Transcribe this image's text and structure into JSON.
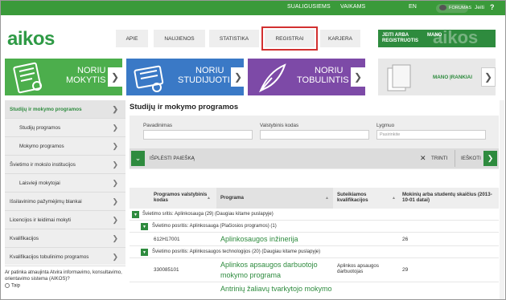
{
  "topbar": {
    "links": [
      "SUALIGUSIEMS",
      "VAIKAMS",
      "EN"
    ],
    "forum_label": "FORUMAS",
    "login_label": "Jeiti",
    "help_label": "?"
  },
  "header": {
    "logo": "aikos",
    "nav": [
      "APIE",
      "NAUJIENOS",
      "STATISTIKA",
      "REGISTRAI",
      "KARJERA"
    ],
    "register_line1": "JEITI ARBA",
    "register_line2": "REGISTRUOTIS",
    "mano_line1": "MANO",
    "mano_watermark": "aikos"
  },
  "tiles": [
    {
      "label1": "NORIU",
      "label2": "MOKYTIS",
      "icon": "certificate-icon",
      "color": "#4cae4c"
    },
    {
      "label1": "NORIU",
      "label2": "STUDIJUOTI",
      "icon": "diploma-icon",
      "color": "#3a79c6"
    },
    {
      "label1": "NORIU",
      "label2": "TOBULINTIS",
      "icon": "quill-icon",
      "color": "#7d4aa7"
    },
    {
      "label1": "MANO ĮRANKIAI",
      "icon": "documents-icon",
      "color": "#e8e8e8"
    }
  ],
  "sidebar": {
    "items": [
      {
        "label": "Studijų ir mokymo programos"
      },
      {
        "label": "Studijų programos"
      },
      {
        "label": "Mokymo programos"
      },
      {
        "label": "Švietimo ir mokslo institucijos"
      },
      {
        "label": "Laisvieji mokytojai"
      },
      {
        "label": "Išsilavinimo pažymėjimų blankai"
      },
      {
        "label": "Licencijos ir leidimai mokyti"
      },
      {
        "label": "Kvalifikacijos"
      },
      {
        "label": "Kvalifikacijos tobulinimo programos"
      }
    ],
    "survey_question": "Ar patinka atnaujinta Atvira informavimo, konsultavimo, orientavimo sistema (AIKOS)?",
    "survey_option": "Taip"
  },
  "main": {
    "title": "Studijų ir mokymo programos",
    "filters": {
      "name_label": "Pavadinimas",
      "code_label": "Valstybinis kodas",
      "level_label": "Lygmuo",
      "level_placeholder": "Pasirinkite"
    },
    "expand_search": "IŠPLĖSTI PAIEŠKĄ",
    "clear": "TRINTI",
    "search": "IEŠKOTI",
    "table": {
      "headers": {
        "code": "Programos valstybinis kodas",
        "program": "Programa",
        "qualification": "Suteikiamos kvalifikacijos",
        "students": "Mokinių arba studentų skaičius (2013-10-01 datai)"
      },
      "group1": "Švietimo sritis: Aplinkosauga (29) (Daugiau kitame puslapyje)",
      "group2": "Švietimo posritis: Aplinkosauga (Plačiosios programos) (1)",
      "group3": "Švietimo posritis: Aplinkosaugos technologijos (20) (Daugiau kitame puslapyje)",
      "rows": [
        {
          "code": "612H17001",
          "program": "Aplinkosaugos inžinerija",
          "qualification": "",
          "students": "26"
        },
        {
          "code": "330085101",
          "program": "Aplinkos apsaugos darbuotojo mokymo programa",
          "qualification": "Aplinkos apsaugos darbuotojas",
          "students": "29"
        },
        {
          "code": "",
          "program": "Antrinių žaliavų tvarkytojo mokymo",
          "qualification": "",
          "students": ""
        }
      ]
    }
  }
}
